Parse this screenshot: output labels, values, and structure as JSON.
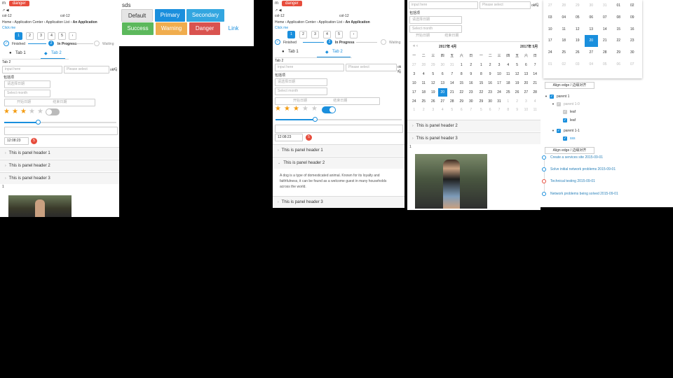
{
  "left": {
    "top_icons": "m",
    "danger": "danger",
    "icons_line": "↗ ◀",
    "col1": "col-12",
    "col2": "col-12",
    "breadcrumb": [
      "Home",
      "Application Center",
      "Application List",
      "An Application"
    ],
    "clickme": "Click me",
    "pages": [
      "1",
      "2",
      "3",
      "4",
      "5",
      "›"
    ],
    "steps": [
      "Finished",
      "In Progress",
      "Waiting"
    ],
    "tabs": [
      "Tab 1",
      "Tab 2"
    ],
    "tab_content": "Tab 2",
    "input_ph": "input here",
    "select_ph": "Please select",
    "suffix": "ok吗",
    "field_label": "包括项",
    "date_ph": "请选择日期",
    "month_ph": "Select month",
    "range_start": "开始日期",
    "range_end": "结束日期",
    "number": "12:08:23",
    "badge": "5",
    "panels": [
      "This is panel header 1",
      "This is panel header 2",
      "This is panel header 3"
    ],
    "below": "1"
  },
  "buttons": {
    "title": "sds",
    "labels": [
      "Default",
      "Primary",
      "Secondary",
      "Success",
      "Warning",
      "Danger",
      "Link"
    ]
  },
  "middle": {
    "top_icons": "m",
    "danger": "danger",
    "icons_line": "↗ ◀",
    "col1": "col-12",
    "col2": "col-12",
    "breadcrumb": [
      "Home",
      "Application Center",
      "Application List",
      "An Application"
    ],
    "clickme": "Click me",
    "pages": [
      "1",
      "2",
      "3",
      "4",
      "5",
      "›"
    ],
    "steps": [
      "Finished",
      "In Progress",
      "Waiting"
    ],
    "tabs": [
      "Tab 1",
      "Tab 2"
    ],
    "tab_content": "Tab 2",
    "input_ph": "input here",
    "select_ph": "Please select",
    "suffix": "ok吗",
    "field_label": "包括项",
    "date_ph": "请选择日期",
    "month_ph": "Select month",
    "range_start": "开始日期",
    "range_end": "结束日期",
    "number": "12:08:23",
    "badge": "5",
    "panels": [
      "This is panel header 1",
      "This is panel header 2",
      "This is panel header 3"
    ],
    "panel_text": "A dog is a type of domesticated animal. Known for its loyalty and faithfulness, it can be found as a welcome guest in many households across the world."
  },
  "calendar": {
    "input_ph": "input here",
    "select_ph": "Please select",
    "suffix": "ok吗",
    "field_label": "包括项",
    "date_ph": "请选择日期",
    "month_ph": "Select month",
    "range_start": "开始日期",
    "range_end": "结束日期",
    "left_month": "2017年 4月",
    "right_month": "2017年 5月",
    "weekdays": [
      "一",
      "二",
      "三",
      "四",
      "五",
      "六",
      "日"
    ],
    "left_days": [
      [
        "27",
        "28",
        "29",
        "30",
        "31",
        "1",
        "2"
      ],
      [
        "3",
        "4",
        "5",
        "6",
        "7",
        "8",
        "9"
      ],
      [
        "10",
        "11",
        "12",
        "13",
        "14",
        "15",
        "16"
      ],
      [
        "17",
        "18",
        "19",
        "20",
        "21",
        "22",
        "23"
      ],
      [
        "24",
        "25",
        "26",
        "27",
        "28",
        "29",
        "30"
      ],
      [
        "1",
        "2",
        "3",
        "4",
        "5",
        "6",
        "7"
      ]
    ],
    "right_days": [
      [
        "1",
        "2",
        "3",
        "4",
        "5",
        "6",
        "7"
      ],
      [
        "8",
        "9",
        "10",
        "11",
        "12",
        "13",
        "14"
      ],
      [
        "15",
        "16",
        "17",
        "18",
        "19",
        "20",
        "21"
      ],
      [
        "22",
        "23",
        "24",
        "25",
        "26",
        "27",
        "28"
      ],
      [
        "29",
        "30",
        "31",
        "1",
        "2",
        "3",
        "4"
      ],
      [
        "5",
        "6",
        "7",
        "8",
        "9",
        "10",
        "11"
      ]
    ],
    "panels": [
      "This is panel header 2",
      "This is panel header 3"
    ],
    "below": "1"
  },
  "right": {
    "cal_rows": [
      [
        "27",
        "28",
        "29",
        "30",
        "31",
        "01",
        "02"
      ],
      [
        "03",
        "04",
        "05",
        "06",
        "07",
        "08",
        "09"
      ],
      [
        "10",
        "11",
        "12",
        "13",
        "14",
        "15",
        "16"
      ],
      [
        "17",
        "18",
        "19",
        "20",
        "21",
        "22",
        "23"
      ],
      [
        "24",
        "25",
        "26",
        "27",
        "28",
        "29",
        "30"
      ],
      [
        "01",
        "02",
        "03",
        "04",
        "05",
        "06",
        "07"
      ]
    ],
    "align_btn": "Align edge / 边缘对齐",
    "tree": [
      "parent 1",
      "parent 1-0",
      "leaf",
      "leaf",
      "parent 1-1",
      "sss"
    ],
    "timeline": [
      "Create a services site 2015-09-01",
      "Solve initial network problems 2015-09-01",
      "Technical testing 2015-09-01",
      "Network problems being solved 2015-09-01"
    ]
  },
  "colors": {
    "primary": "#1a8fdd",
    "danger": "#e74c3c",
    "success": "#5cb85c",
    "warning": "#f0ad4e",
    "secondary": "#33a6e0"
  }
}
